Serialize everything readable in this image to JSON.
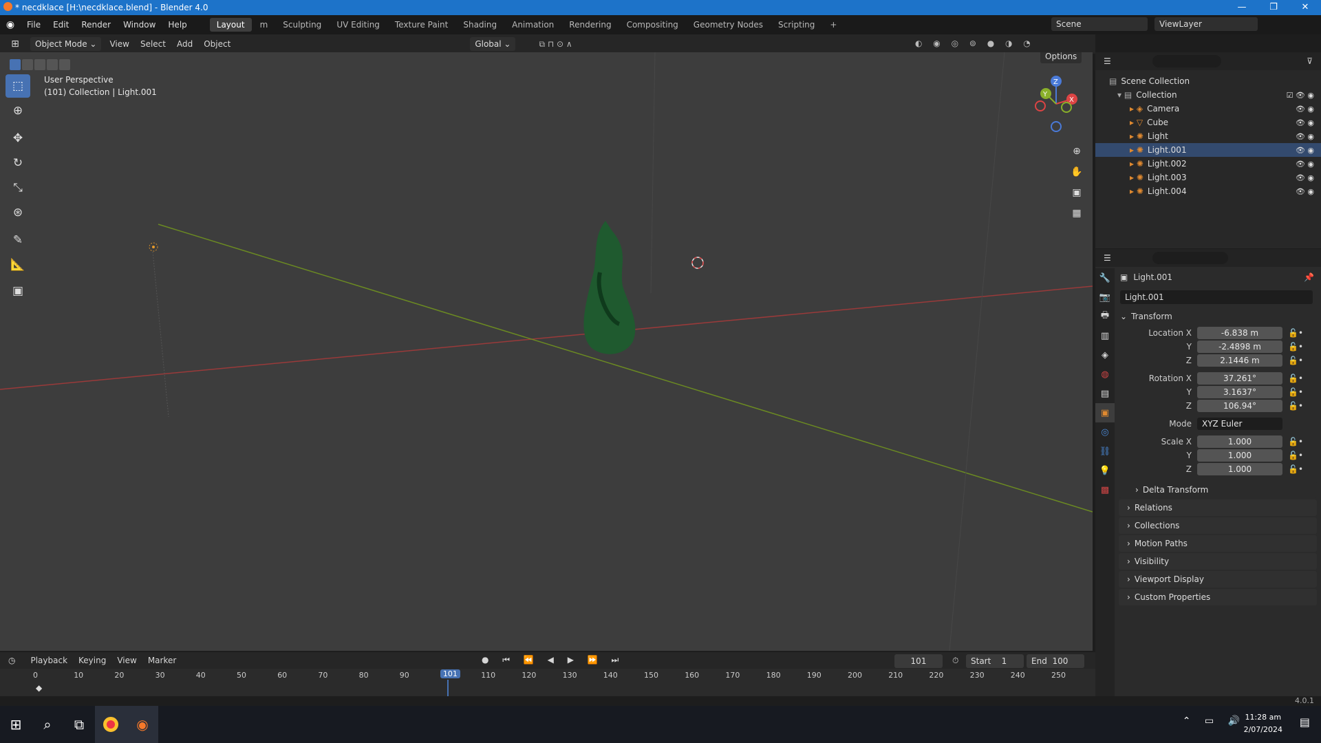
{
  "window": {
    "title": "* necdklace [H:\\necdklace.blend] - Blender 4.0",
    "min": "—",
    "max": "❐",
    "close": "✕"
  },
  "menu": [
    "File",
    "Edit",
    "Render",
    "Window",
    "Help"
  ],
  "workspaces": [
    "Layout",
    "m",
    "Sculpting",
    "UV Editing",
    "Texture Paint",
    "Shading",
    "Animation",
    "Rendering",
    "Compositing",
    "Geometry Nodes",
    "Scripting",
    "+"
  ],
  "scene": {
    "name": "Scene",
    "viewlayer": "ViewLayer"
  },
  "viewport_header": {
    "mode": "Object Mode",
    "menus": [
      "View",
      "Select",
      "Add",
      "Object"
    ],
    "orientation": "Global",
    "options": "Options"
  },
  "viewport": {
    "line1": "User Perspective",
    "line2": "(101) Collection | Light.001",
    "gizmo": {
      "x": "X",
      "y": "Y",
      "z": "Z"
    }
  },
  "outliner": {
    "root": "Scene Collection",
    "collection": "Collection",
    "items": [
      "Camera",
      "Cube",
      "Light",
      "Light.001",
      "Light.002",
      "Light.003",
      "Light.004"
    ]
  },
  "properties": {
    "object_name": "Light.001",
    "data_name": "Light.001",
    "transform_label": "Transform",
    "location": {
      "label": "Location X",
      "x": "-6.838 m",
      "y": "-2.4898 m",
      "z": "2.1446 m"
    },
    "rotation": {
      "label": "Rotation X",
      "x": "37.261°",
      "y": "3.1637°",
      "z": "106.94°"
    },
    "mode": {
      "label": "Mode",
      "value": "XYZ Euler"
    },
    "scale": {
      "label": "Scale X",
      "x": "1.000",
      "y": "1.000",
      "z": "1.000"
    },
    "axis_y": "Y",
    "axis_z": "Z",
    "panels": [
      "Delta Transform",
      "Relations",
      "Collections",
      "Motion Paths",
      "Visibility",
      "Viewport Display",
      "Custom Properties"
    ]
  },
  "timeline": {
    "menus": [
      "Playback",
      "Keying",
      "View",
      "Marker"
    ],
    "current": "101",
    "start_label": "Start",
    "start": "1",
    "end_label": "End",
    "end": "100",
    "ticks": [
      "0",
      "10",
      "20",
      "30",
      "40",
      "50",
      "60",
      "70",
      "80",
      "90",
      "100",
      "110",
      "120",
      "130",
      "140",
      "150",
      "160",
      "170",
      "180",
      "190",
      "200",
      "210",
      "220",
      "230",
      "240",
      "250"
    ],
    "playhead": "101"
  },
  "statusbar": {
    "version": "4.0.1"
  },
  "taskbar": {
    "time": "11:28 am",
    "date": "2/07/2024"
  }
}
